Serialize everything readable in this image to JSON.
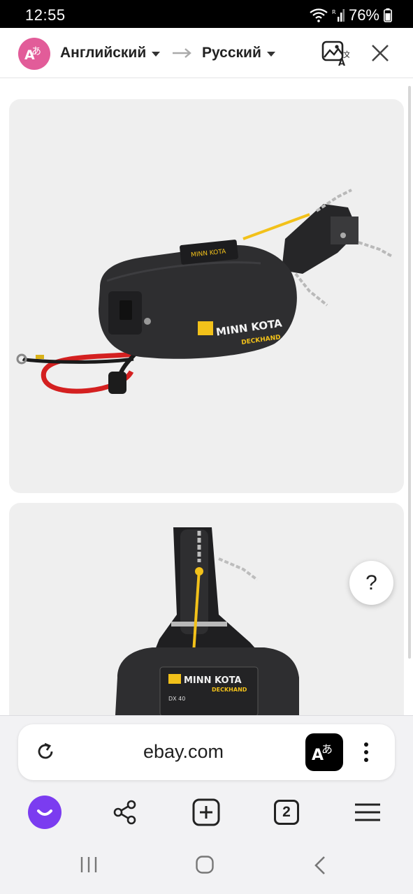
{
  "status_bar": {
    "time": "12:55",
    "battery": "76%"
  },
  "translate_bar": {
    "source_language": "Английский",
    "target_language": "Русский",
    "badge_glyph": "あ"
  },
  "content": {
    "product_images": [
      {
        "brand_text": "MINN KOTA",
        "sub_text": "DECKHAND"
      },
      {
        "brand_text": "MINN KOTA",
        "sub_text": "DECKHAND",
        "model_text": "DX 40"
      }
    ],
    "help_label": "?"
  },
  "browser": {
    "url": "ebay.com",
    "translate_glyph": "あ",
    "tab_count": "2"
  },
  "icons": {
    "status": [
      "wifi-icon",
      "signal-icon",
      "battery-icon"
    ],
    "toolbar": [
      "image-translate-icon",
      "close-icon"
    ],
    "address_bar": [
      "reload-icon",
      "translate-icon",
      "more-icon"
    ],
    "nav": [
      "alice-icon",
      "share-icon",
      "new-tab-icon",
      "tabs-icon",
      "menu-icon"
    ],
    "system": [
      "recents-icon",
      "home-icon",
      "back-icon"
    ]
  },
  "colors": {
    "accent_pink": "#e25c99",
    "alice_purple": "#7b3cf0",
    "product_body": "#2e2e30",
    "brand_yellow": "#f2c11a",
    "cable_red": "#d42020"
  }
}
